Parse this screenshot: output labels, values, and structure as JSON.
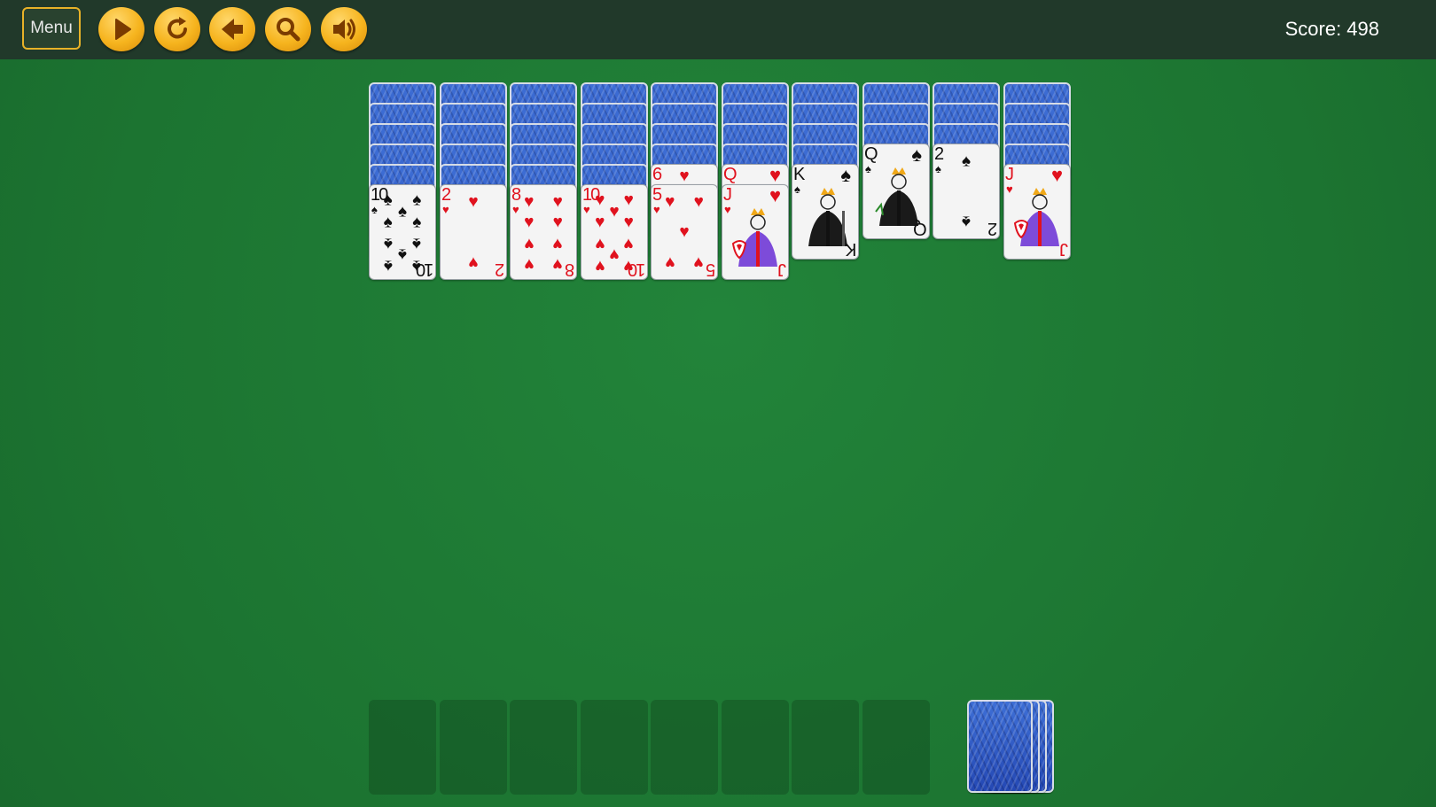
{
  "toolbar": {
    "menu_label": "Menu",
    "buttons": [
      {
        "name": "play-button",
        "icon": "play-icon"
      },
      {
        "name": "restart-button",
        "icon": "restart-icon"
      },
      {
        "name": "undo-button",
        "icon": "undo-arrow-icon"
      },
      {
        "name": "hint-button",
        "icon": "magnifier-icon"
      },
      {
        "name": "sound-button",
        "icon": "speaker-icon"
      }
    ],
    "score_text": "Score: 498"
  },
  "colors": {
    "felt": "#1e7a35",
    "topbar": "#21392a",
    "accent": "#f6b41e",
    "card_back": "#2d56c2",
    "red_suit": "#e0121e"
  },
  "tableau": [
    {
      "face_down": 5,
      "face_up": [
        {
          "rank": "10",
          "suit": "♠",
          "color": "black"
        }
      ]
    },
    {
      "face_down": 5,
      "face_up": [
        {
          "rank": "2",
          "suit": "♥",
          "color": "red"
        }
      ]
    },
    {
      "face_down": 5,
      "face_up": [
        {
          "rank": "8",
          "suit": "♥",
          "color": "red"
        }
      ]
    },
    {
      "face_down": 5,
      "face_up": [
        {
          "rank": "10",
          "suit": "♥",
          "color": "red"
        }
      ]
    },
    {
      "face_down": 4,
      "face_up": [
        {
          "rank": "6",
          "suit": "♥",
          "color": "red"
        },
        {
          "rank": "5",
          "suit": "♥",
          "color": "red"
        }
      ]
    },
    {
      "face_down": 4,
      "face_up": [
        {
          "rank": "Q",
          "suit": "♥",
          "color": "red"
        },
        {
          "rank": "J",
          "suit": "♥",
          "color": "red"
        }
      ]
    },
    {
      "face_down": 4,
      "face_up": [
        {
          "rank": "K",
          "suit": "♠",
          "color": "black"
        }
      ]
    },
    {
      "face_down": 3,
      "face_up": [
        {
          "rank": "Q",
          "suit": "♠",
          "color": "black"
        }
      ]
    },
    {
      "face_down": 3,
      "face_up": [
        {
          "rank": "2",
          "suit": "♠",
          "color": "black"
        }
      ]
    },
    {
      "face_down": 4,
      "face_up": [
        {
          "rank": "J",
          "suit": "♥",
          "color": "red"
        }
      ]
    }
  ],
  "foundation_slots": 8,
  "stock_piles": 4
}
